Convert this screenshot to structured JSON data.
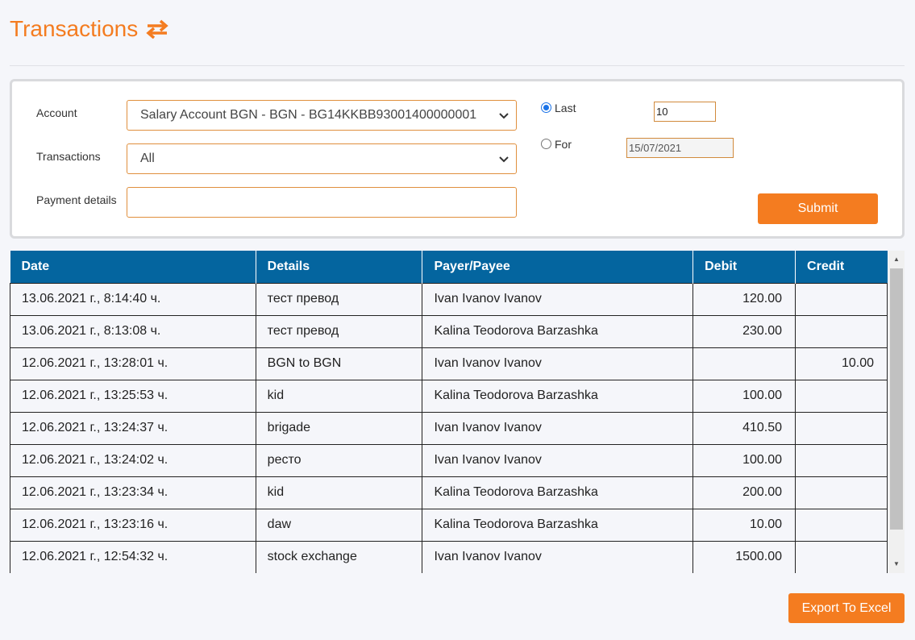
{
  "page": {
    "title": "Transactions",
    "title_icon": "exchange-arrows-icon",
    "accent_color": "#f47c20"
  },
  "filters": {
    "account_label": "Account",
    "account_value": "Salary Account BGN - BGN - BG14KKBB93001400000001",
    "transactions_label": "Transactions",
    "transactions_value": "All",
    "payment_details_label": "Payment details",
    "payment_details_value": "",
    "last_label": "Last",
    "last_value": "10",
    "last_checked": true,
    "for_label": "For",
    "for_value": "15/07/2021",
    "for_checked": false,
    "submit_label": "Submit"
  },
  "table": {
    "header_color": "#04659f",
    "columns": [
      "Date",
      "Details",
      "Payer/Payee",
      "Debit",
      "Credit"
    ],
    "rows": [
      [
        "13.06.2021 г., 8:14:40 ч.",
        "тест превод",
        "Ivan Ivanov Ivanov",
        "120.00",
        ""
      ],
      [
        "13.06.2021 г., 8:13:08 ч.",
        "тест превод",
        "Kalina Teodorova Barzashka",
        "230.00",
        ""
      ],
      [
        "12.06.2021 г., 13:28:01 ч.",
        "BGN to BGN",
        "Ivan Ivanov Ivanov",
        "",
        "10.00"
      ],
      [
        "12.06.2021 г., 13:25:53 ч.",
        "kid",
        "Kalina Teodorova Barzashka",
        "100.00",
        ""
      ],
      [
        "12.06.2021 г., 13:24:37 ч.",
        "brigade",
        "Ivan Ivanov Ivanov",
        "410.50",
        ""
      ],
      [
        "12.06.2021 г., 13:24:02 ч.",
        "ресто",
        "Ivan Ivanov Ivanov",
        "100.00",
        ""
      ],
      [
        "12.06.2021 г., 13:23:34 ч.",
        "kid",
        "Kalina Teodorova Barzashka",
        "200.00",
        ""
      ],
      [
        "12.06.2021 г., 13:23:16 ч.",
        "daw",
        "Kalina Teodorova Barzashka",
        "10.00",
        ""
      ],
      [
        "12.06.2021 г., 12:54:32 ч.",
        "stock exchange",
        "Ivan Ivanov Ivanov",
        "1500.00",
        ""
      ]
    ]
  },
  "export_label": "Export To Excel"
}
